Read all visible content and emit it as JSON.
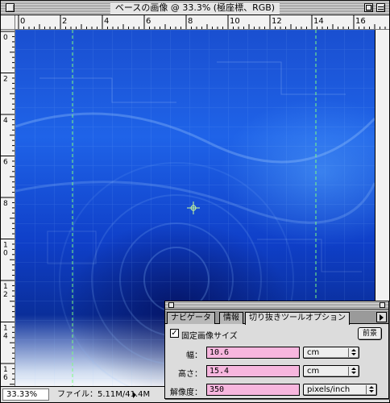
{
  "window": {
    "title": "ベースの画像 @ 33.3% (極座標、RGB)"
  },
  "rulers": {
    "horizontal_labels": [
      "0",
      "2",
      "4",
      "6",
      "8",
      "10",
      "12",
      "14",
      "16"
    ],
    "vertical_labels": [
      "0",
      "2",
      "4",
      "6",
      "8",
      "1\n0",
      "1\n2",
      "1\n4",
      "1\n6"
    ]
  },
  "status": {
    "zoom": "33.33%",
    "file_info": "ファイル：5.11M/41.4M"
  },
  "palette": {
    "tabs": [
      {
        "label": "ナビゲータ",
        "active": false
      },
      {
        "label": "情報",
        "active": false
      },
      {
        "label": "切り抜きツールオプション",
        "active": true
      }
    ],
    "fixed_size": {
      "checked": true,
      "label": "固定画像サイズ"
    },
    "front_button": "前景",
    "width": {
      "label": "幅：",
      "value": "10.6",
      "unit": "cm"
    },
    "height": {
      "label": "高さ：",
      "value": "15.4",
      "unit": "cm"
    },
    "resolution": {
      "label": "解像度：",
      "value": "350",
      "unit": "pixels/inch"
    }
  },
  "colors": {
    "guide": "#7cff7c",
    "input_bg": "#f7b6de"
  }
}
